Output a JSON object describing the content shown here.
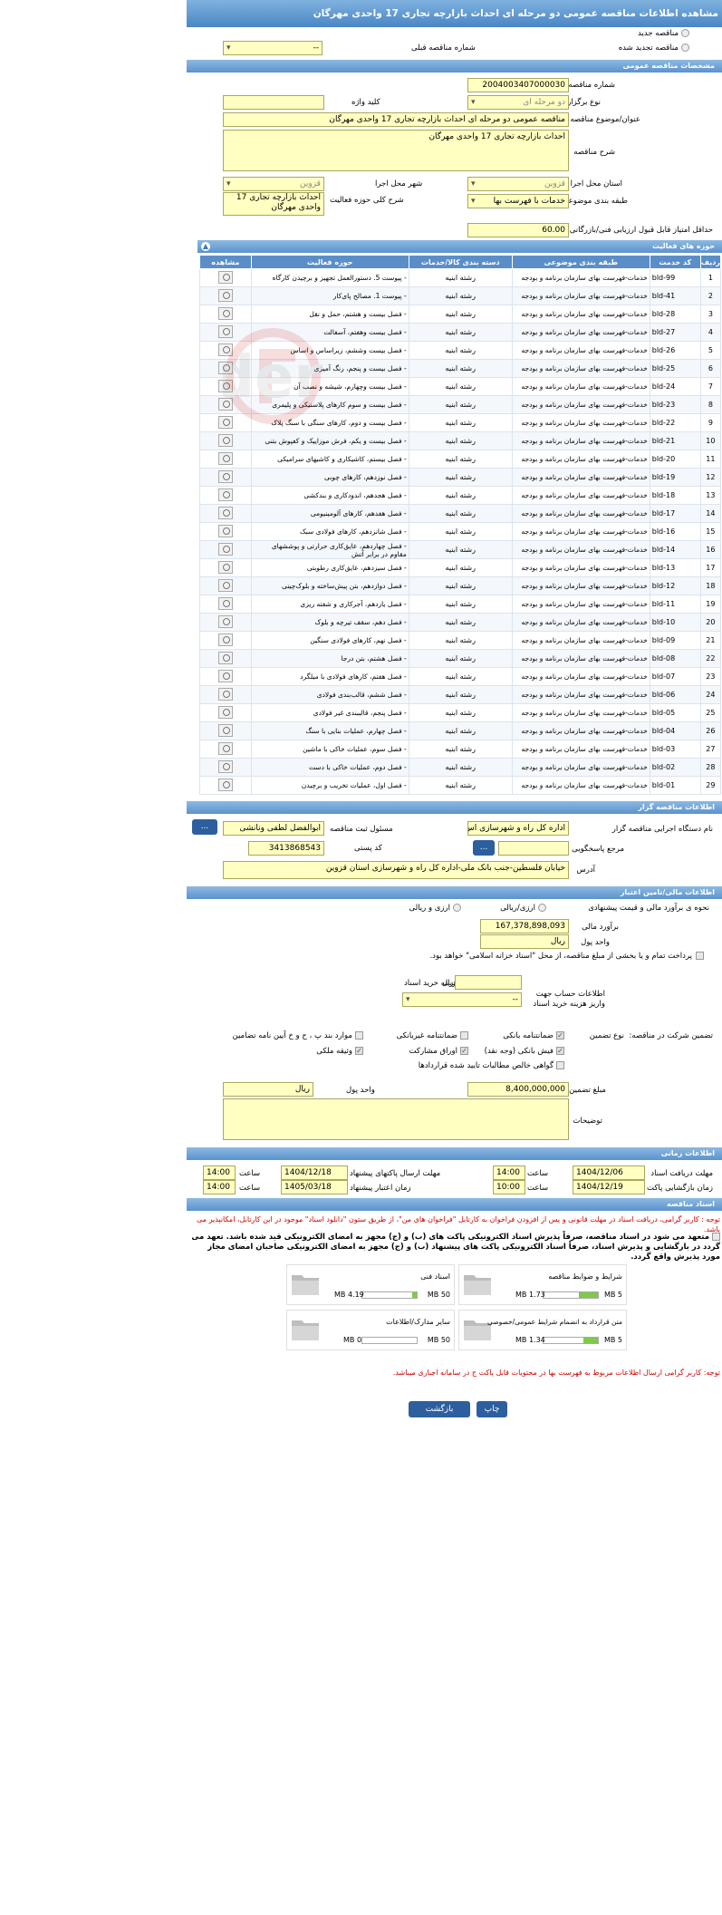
{
  "window": {
    "title": "مشاهده اطلاعات مناقصه عمومی دو مرحله ای احداث بازارچه تجاری 17 واحدی مهرگان"
  },
  "top": {
    "new_tender": "مناقصه جدید",
    "renewed_tender": "مناقصه تجدید شده",
    "prev_number_label": "شماره مناقصه قبلی",
    "prev_number_value": "--"
  },
  "general": {
    "section": "مشخصات مناقصه عمومی",
    "number_label": "شماره مناقصه",
    "number_value": "2004003407000030",
    "type_label": "نوع برگزاری",
    "type_value": "دو مرحله ای",
    "keyword_label": "کلید واژه",
    "keyword_value": "",
    "subject_label": "عنوان/موضوع مناقصه",
    "subject_value": "مناقصه عمومی دو مرحله ای احداث بازارچه تجاری 17 واحدی مهرگان",
    "desc_label": "شرح مناقصه",
    "desc_value": "احداث بازارچه تجاری 17 واحدی مهرگان",
    "province_label": "استان محل اجرا",
    "province_value": "قزوین",
    "city_label": "شهر محل اجرا",
    "city_value": "قزوین",
    "category_label": "طبقه بندی موضوعی",
    "category_value": "خدمات با فهرست بها",
    "activity_desc_label": "شرح کلی حوزه فعالیت",
    "activity_desc_value": "احداث بازارچه تجاری 17 واحدی مهرگان",
    "min_score_label": "حداقل امتیاز قابل قبول ارزیابی فنی/بازرگانی",
    "min_score_value": "60.00"
  },
  "activities": {
    "section": "حوزه های فعالیت",
    "headers": [
      "ردیف",
      "کد خدمت",
      "طبقه بندی موضوعی",
      "دسته بندی کالا/خدمات",
      "حوزه فعالیت",
      "مشاهده"
    ],
    "category_text": "خدمات-فهرست بهای سازمان برنامه و بودجه",
    "group_text": "رشته ابنیه",
    "rows": [
      {
        "n": "1",
        "code": "bld-99",
        "field": "- پیوست 5. دستورالعمل تجهیز و برچیدن کارگاه"
      },
      {
        "n": "2",
        "code": "bld-41",
        "field": "- پیوست 1. مصالح پای‌کار"
      },
      {
        "n": "3",
        "code": "bld-28",
        "field": "- فصل بیست و هشتم، حمل و نقل"
      },
      {
        "n": "4",
        "code": "bld-27",
        "field": "- فصل بیست وهفتم، آسفالت"
      },
      {
        "n": "5",
        "code": "bld-26",
        "field": "- فصل بیست وششم، زیراساس و اساس"
      },
      {
        "n": "6",
        "code": "bld-25",
        "field": "- فصل بیست و پنجم، رنگ آمیزی"
      },
      {
        "n": "7",
        "code": "bld-24",
        "field": "- فصل بیست وچهارم، شیشه و نصب آن"
      },
      {
        "n": "8",
        "code": "bld-23",
        "field": "- فصل بیست و سوم کارهای پلاستیکی و پلیمری"
      },
      {
        "n": "9",
        "code": "bld-22",
        "field": "- فصل بیست و دوم، کارهای سنگی با سنگ پلاک"
      },
      {
        "n": "10",
        "code": "bld-21",
        "field": "- فصل بیست و یکم، فرش موزاییک و کفپوش بتنی"
      },
      {
        "n": "11",
        "code": "bld-20",
        "field": "- فصل بیستم، کاشیکاری و کاشیهای سرامیکی"
      },
      {
        "n": "12",
        "code": "bld-19",
        "field": "- فصل نوزدهم، کارهای چوبی"
      },
      {
        "n": "13",
        "code": "bld-18",
        "field": "- فصل هجدهم، اندودکاری و بندکشی"
      },
      {
        "n": "14",
        "code": "bld-17",
        "field": "- فصل هفدهم، کارهای آلومینیومی"
      },
      {
        "n": "15",
        "code": "bld-16",
        "field": "- فصل شانزدهم، کارهای فولادی سبک"
      },
      {
        "n": "16",
        "code": "bld-14",
        "field": "- فصل چهاردهم، عایق‌کاری حرارتی و پوششهای مقاوم در برابر آتش"
      },
      {
        "n": "17",
        "code": "bld-13",
        "field": "- فصل سیزدهم، عایق‌کاری رطوبتی"
      },
      {
        "n": "18",
        "code": "bld-12",
        "field": "- فصل دوازدهم، بتن پیش‌ساخته و بلوک‌چینی"
      },
      {
        "n": "19",
        "code": "bld-11",
        "field": "- فصل یازدهم، آجرکاری و شفته ریزی"
      },
      {
        "n": "20",
        "code": "bld-10",
        "field": "- فصل دهم، سقف تیرچه و بلوک"
      },
      {
        "n": "21",
        "code": "bld-09",
        "field": "- فصل نهم، کارهای فولادی سنگین"
      },
      {
        "n": "22",
        "code": "bld-08",
        "field": "- فصل هشتم، بتن درجا"
      },
      {
        "n": "23",
        "code": "bld-07",
        "field": "- فصل هفتم، کارهای فولادی با میلگرد"
      },
      {
        "n": "24",
        "code": "bld-06",
        "field": "- فصل ششم، قالب‌بندی فولادی"
      },
      {
        "n": "25",
        "code": "bld-05",
        "field": "- فصل پنجم، قالببندی غیر فولادی"
      },
      {
        "n": "26",
        "code": "bld-04",
        "field": "- فصل چهارم، عملیات بنایی با سنگ"
      },
      {
        "n": "27",
        "code": "bld-03",
        "field": "- فصل سوم، عملیات خاکی با ماشین"
      },
      {
        "n": "28",
        "code": "bld-02",
        "field": "- فصل دوم، عملیات خاکی با دست"
      },
      {
        "n": "29",
        "code": "bld-01",
        "field": "- فصل اول، عملیات تخریب و برچیدن"
      }
    ]
  },
  "organizer": {
    "section": "اطلاعات مناقصه گزار",
    "org_label": "نام دستگاه اجرایی مناقصه گزار",
    "org_value": "اداره کل راه و شهرسازی اس",
    "officer_label": "مسئول ثبت مناقصه",
    "officer_value": "ابوالفضل  لطفی ونانشی",
    "ref_label": "مرجع پاسخگویی",
    "ref_value": "",
    "postal_label": "کد پستی",
    "postal_value": "3413868543",
    "address_label": "آدرس",
    "address_value": "خیابان فلسطین-جنب بانک ملی-اداره کل راه و شهرسازی استان قزوین",
    "more_btn": "..."
  },
  "finance": {
    "section": "اطلاعات مالی/تامین اعتبار",
    "estimate_label": "نحوه ی برآورد مالی و قیمت پیشنهادی",
    "opt_rial_fx": "ارزی/ریالی",
    "opt_fx_and_rial": "ارزی و ریالی",
    "estimate_amount_label": "برآورد مالی",
    "estimate_amount_value": "167,378,898,093",
    "currency_label": "واحد پول",
    "currency_value": "ریال",
    "treasury_text": "پرداخت تمام و یا بخشی از مبلغ مناقصه، از محل \"اسناد خزانه اسلامی\" خواهد بود.",
    "doc_cost_label": "هزینه خرید اسناد",
    "doc_cost_value": "",
    "doc_cost_unit": "ریال",
    "account_label": "اطلاعات حساب جهت واریز هزینه خرید اسناد",
    "account_value": "--"
  },
  "guarantee": {
    "participation_label": "تضمین شرکت در مناقصه:",
    "type_label": "نوع تضمین",
    "options": [
      "ضمانتنامه بانکی",
      "ضمانتنامه غیربانکی",
      "موارد بند پ ، ح و خ آیین نامه تضامین",
      "فیش بانکی (وجه نقد)",
      "اوراق مشارکت",
      "وثیقه ملکی",
      "گواهی خالص مطالبات تایید شده قراردادها"
    ],
    "amount_label": "مبلغ تضمین",
    "amount_value": "8,400,000,000",
    "currency_label": "واحد پول",
    "currency_value": "ریال",
    "notes_label": "توضیحات",
    "notes_value": ""
  },
  "timing": {
    "section": "اطلاعات زمانی",
    "doc_deadline_label": "مهلت دریافت اسناد",
    "doc_deadline_date": "1404/12/06",
    "doc_deadline_time": "14:00",
    "send_deadline_label": "مهلت ارسال پاکتهای پیشنهاد",
    "send_deadline_date": "1404/12/18",
    "send_deadline_time": "14:00",
    "open_label": "زمان بازگشایی پاکت ها",
    "open_date": "1404/12/19",
    "open_time": "10:00",
    "validity_label": "زمان اعتبار پیشنهاد",
    "validity_date": "1405/03/18",
    "validity_time": "14:00",
    "time_label": "ساعت"
  },
  "documents": {
    "section": "اسناد مناقصه",
    "notice1": "توجه : کاربر گرامی، دریافت اسناد در مهلت قانونی و پس از افزودن فراخوان به کارتابل \"فراخوان های من\"، از طریق ستون \"دانلود اسناد\" موجود در این کارتابل، امکانپذیر می باشد.",
    "commitment": "متعهد می شود در اسناد مناقصه، صرفاً پذیرش اسناد الکترونیکی پاکت های (ب) و (ج) مجهز به امضای الکترونیکی قید شده باشد. تعهد می گردد در بارگشایی و پذیرش اسناد، صرفاً اسناد الکترونیکی پاکت های پیشنهاد (ب) و (ج) مجهز به امضای الکترونیکی صاحبان امضای مجاز مورد پذیرش واقع گردد.",
    "files": [
      {
        "name": "شرایط و ضوابط مناقصه",
        "max": "5 MB",
        "size": "1.73 MB",
        "fill": 0.35
      },
      {
        "name": "اسناد فنی",
        "max": "50 MB",
        "size": "4.19 MB",
        "fill": 0.08
      },
      {
        "name": "متن قرارداد به انضمام شرایط عمومی/خصوصی",
        "max": "5 MB",
        "size": "1.34 MB",
        "fill": 0.27
      },
      {
        "name": "سایر مدارک/اطلاعات",
        "max": "50 MB",
        "size": "0 MB",
        "fill": 0.0
      }
    ],
    "notice2": "توجه: کاربر گرامی ارسال اطلاعات مربوط به فهرست بها در محتویات قابل پاکت ج در سامانه اجباری میباشد."
  },
  "footer": {
    "back": "بازگشت",
    "print": "چاپ"
  }
}
